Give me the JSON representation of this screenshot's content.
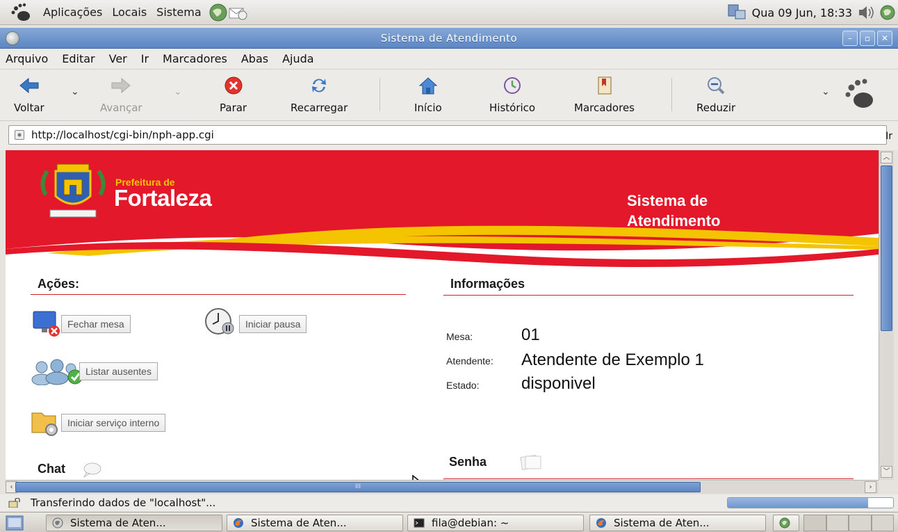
{
  "panel": {
    "menus": [
      "Aplicações",
      "Locais",
      "Sistema"
    ],
    "clock": "Qua 09 Jun, 18:33"
  },
  "window": {
    "title": "Sistema de Atendimento"
  },
  "menubar": {
    "items": [
      "Arquivo",
      "Editar",
      "Ver",
      "Ir",
      "Marcadores",
      "Abas",
      "Ajuda"
    ]
  },
  "toolbar": {
    "back": "Voltar",
    "forward": "Avançar",
    "stop": "Parar",
    "reload": "Recarregar",
    "home": "Início",
    "history": "Histórico",
    "bookmarks": "Marcadores",
    "zoom_out": "Reduzir"
  },
  "location": {
    "url": "http://localhost/cgi-bin/nph-app.cgi",
    "go": "Ir"
  },
  "page": {
    "logo_small": "Prefeitura de",
    "logo_big": "Fortaleza",
    "banner_title_line1": "Sistema de",
    "banner_title_line2": "Atendimento",
    "actions_heading": "Ações:",
    "actions": {
      "close_desk": "Fechar mesa",
      "start_pause": "Iniciar pausa",
      "list_absent": "Listar ausentes",
      "start_internal": "Iniciar serviço interno"
    },
    "chat_heading": "Chat",
    "info_heading": "Informações",
    "info": {
      "desk_label": "Mesa:",
      "desk_value": "01",
      "attendant_label": "Atendente:",
      "attendant_value": "Atendente de Exemplo 1",
      "state_label": "Estado:",
      "state_value": "disponivel"
    },
    "ticket_heading": "Senha"
  },
  "status": {
    "text": "Transferindo dados de \"localhost\"...",
    "progress": 0.85
  },
  "taskbar": {
    "tasks": [
      "Sistema de Aten...",
      "Sistema de Aten...",
      "fila@debian: ~",
      "Sistema de Aten..."
    ]
  },
  "colors": {
    "banner_red": "#e3192b",
    "accent_yellow": "#f4c400",
    "title_blue": "#5b86c4"
  }
}
